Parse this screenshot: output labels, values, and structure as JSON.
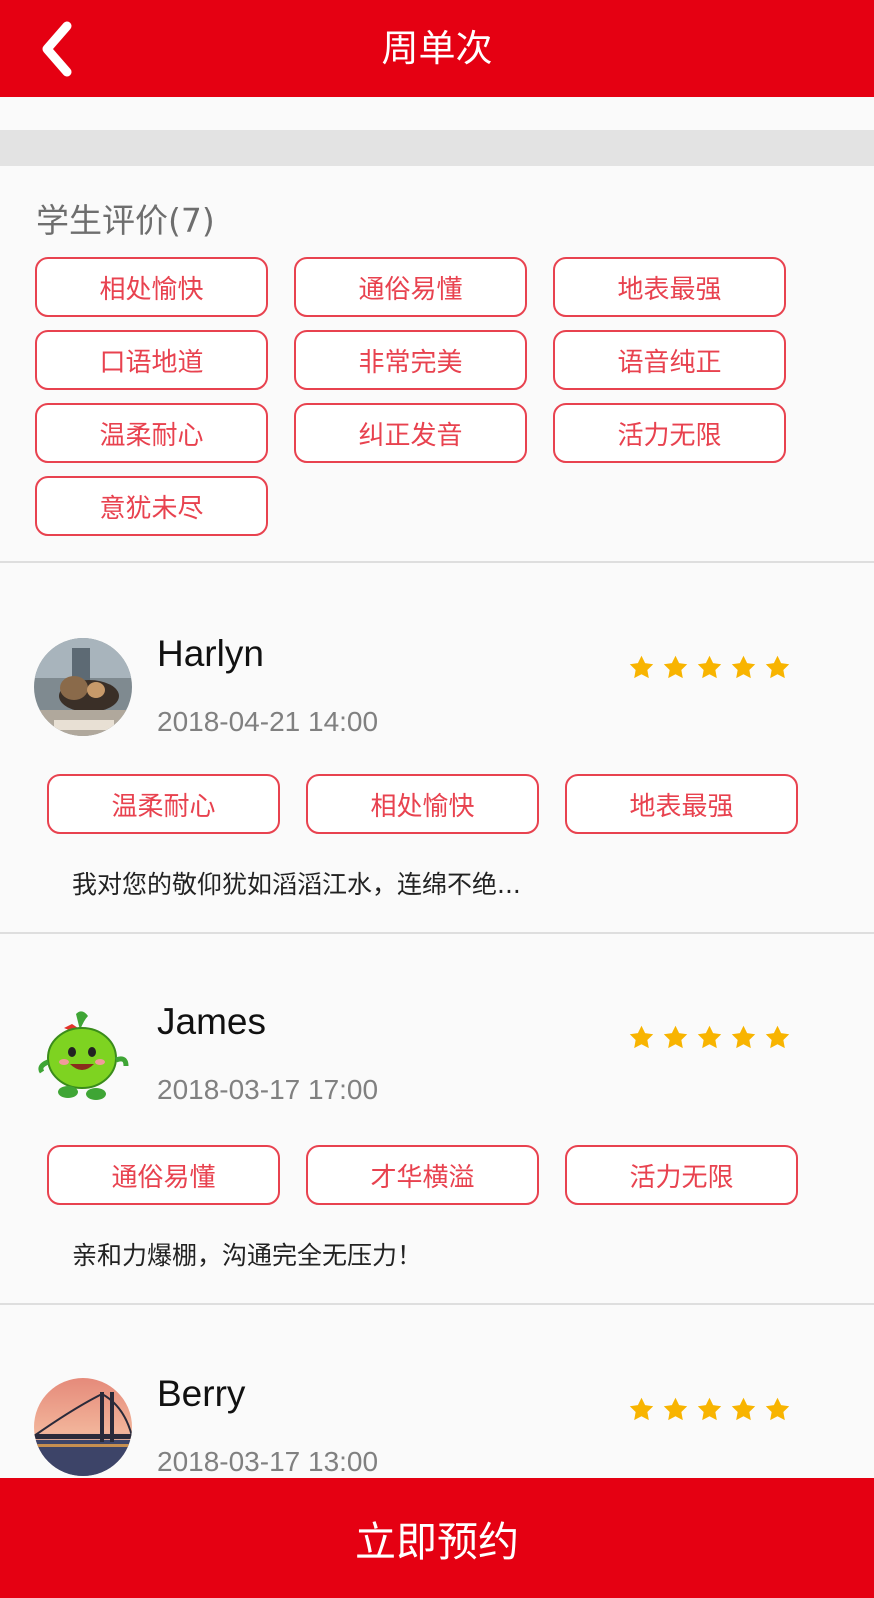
{
  "header": {
    "title": "周单次",
    "back_icon": "chevron-left-icon"
  },
  "ratings_section": {
    "title": "学生评价(7)",
    "tags": [
      "相处愉快",
      "通俗易懂",
      "地表最强",
      "口语地道",
      "非常完美",
      "语音纯正",
      "温柔耐心",
      "纠正发音",
      "活力无限",
      "意犹未尽"
    ]
  },
  "reviews": [
    {
      "name": "Harlyn",
      "date": "2018-04-21 14:00",
      "stars": 5,
      "tags": [
        "温柔耐心",
        "相处愉快",
        "地表最强"
      ],
      "comment": "我对您的敬仰犹如滔滔江水，连绵不绝..."
    },
    {
      "name": "James",
      "date": "2018-03-17 17:00",
      "stars": 5,
      "tags": [
        "通俗易懂",
        "才华横溢",
        "活力无限"
      ],
      "comment": "亲和力爆棚，沟通完全无压力！"
    },
    {
      "name": "Berry",
      "date": "2018-03-17 13:00",
      "stars": 5,
      "tags": [],
      "comment": ""
    }
  ],
  "bottom_button": {
    "label": "立即预约"
  },
  "colors": {
    "brand_red": "#e50012",
    "tag_red": "#e8424f",
    "star_gold": "#f8b400"
  }
}
